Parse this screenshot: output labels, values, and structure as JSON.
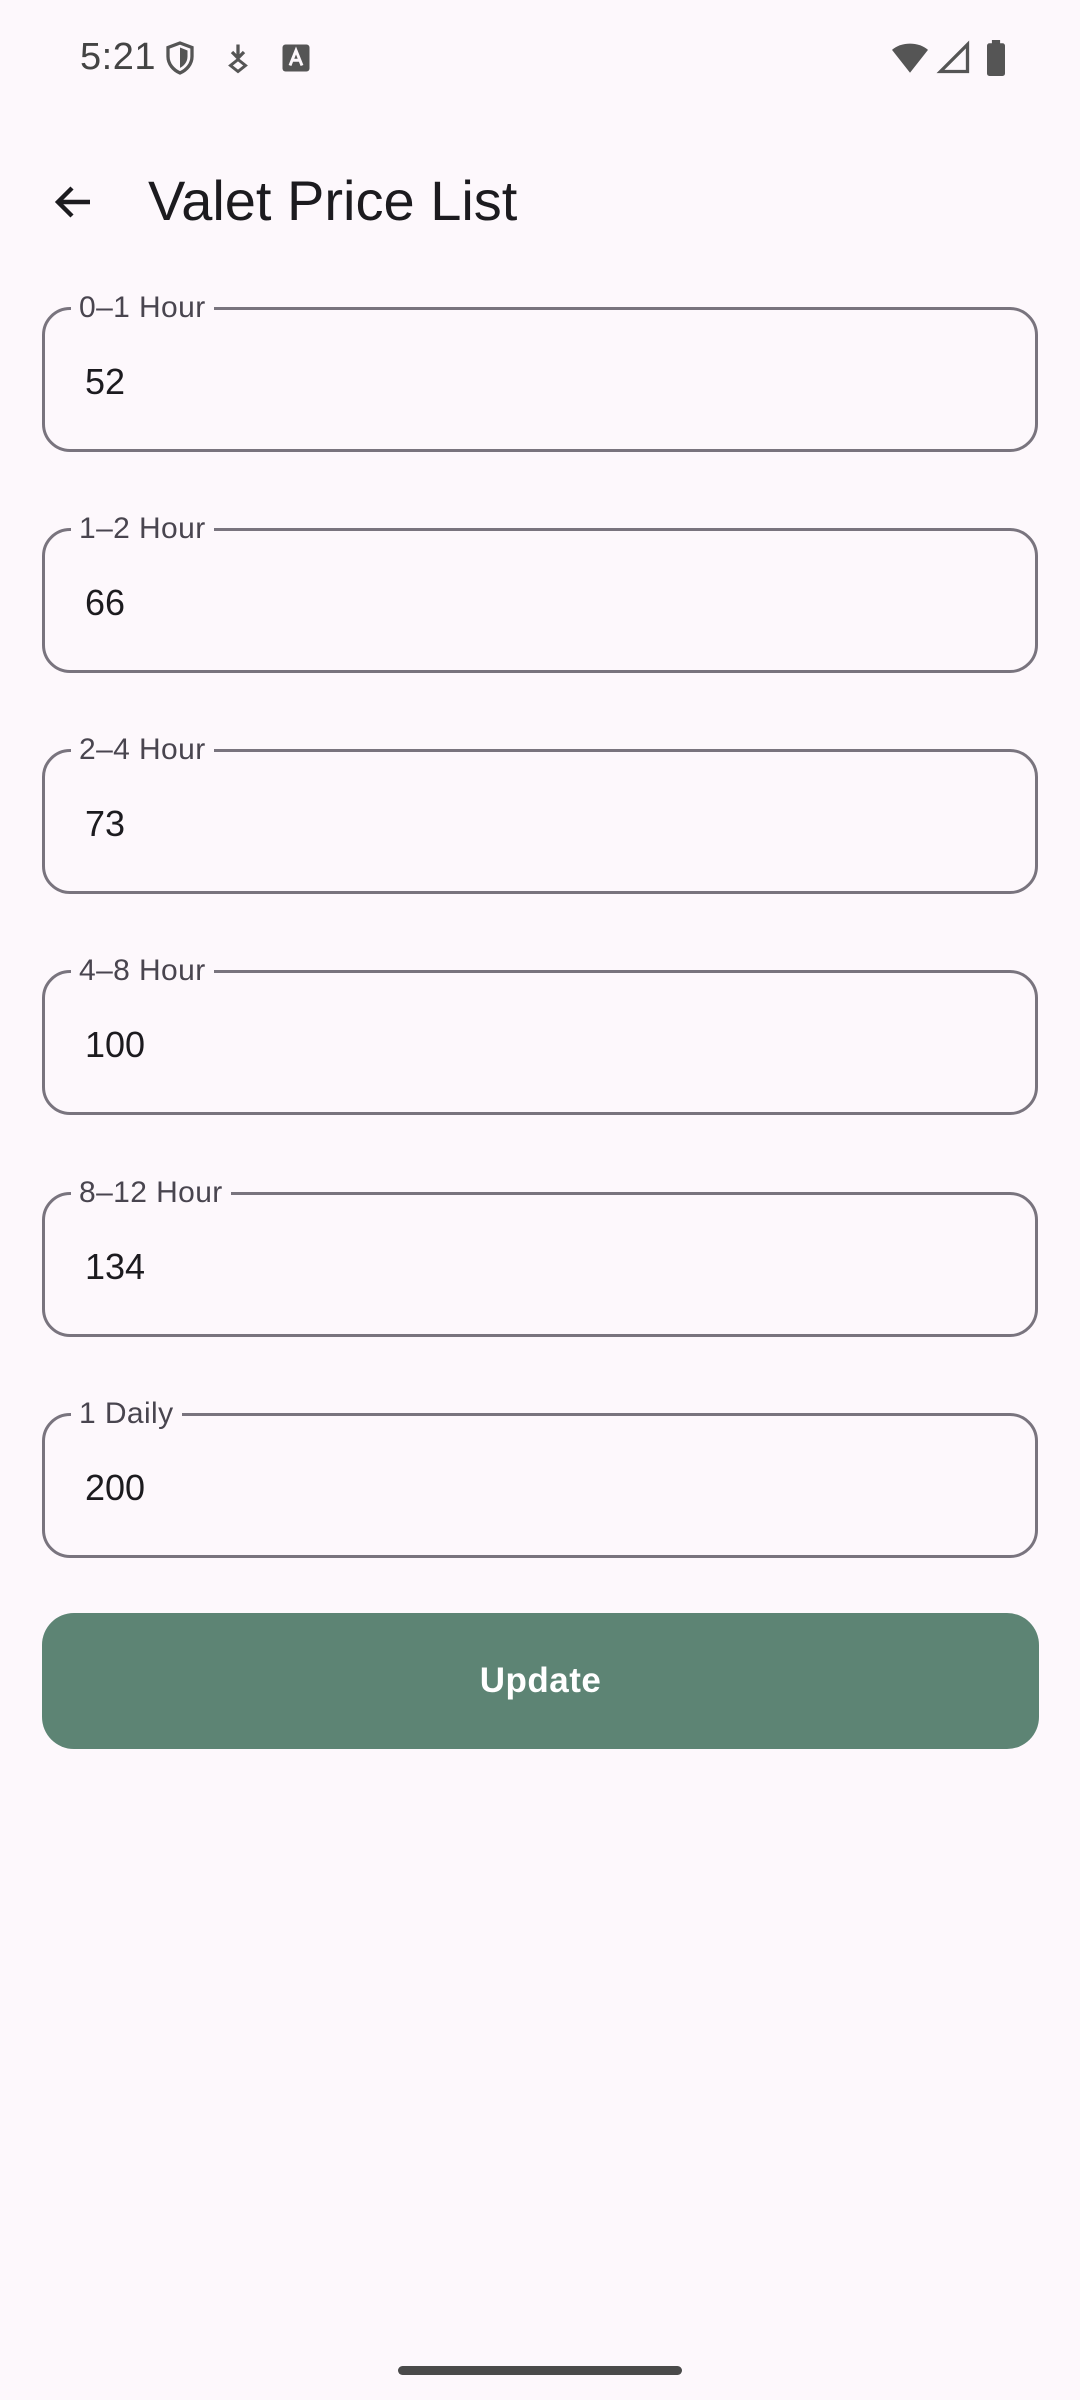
{
  "status_bar": {
    "time": "5:21",
    "left_icons": [
      "shield-icon",
      "download-icon",
      "text-a-icon"
    ],
    "right_icons": [
      "wifi-icon",
      "signal-icon",
      "battery-icon"
    ]
  },
  "app_bar": {
    "back_icon": "arrow-back-icon",
    "title": "Valet Price List"
  },
  "fields": [
    {
      "label": "0–1 Hour",
      "value": "52"
    },
    {
      "label": "1–2 Hour",
      "value": "66"
    },
    {
      "label": "2–4 Hour",
      "value": "73"
    },
    {
      "label": "4–8 Hour",
      "value": "100"
    },
    {
      "label": "8–12 Hour",
      "value": "134"
    },
    {
      "label": "1 Daily",
      "value": "200"
    }
  ],
  "actions": {
    "update_label": "Update"
  },
  "colors": {
    "background": "#fdf8fc",
    "button": "#5d8474",
    "outline": "#79747e"
  }
}
